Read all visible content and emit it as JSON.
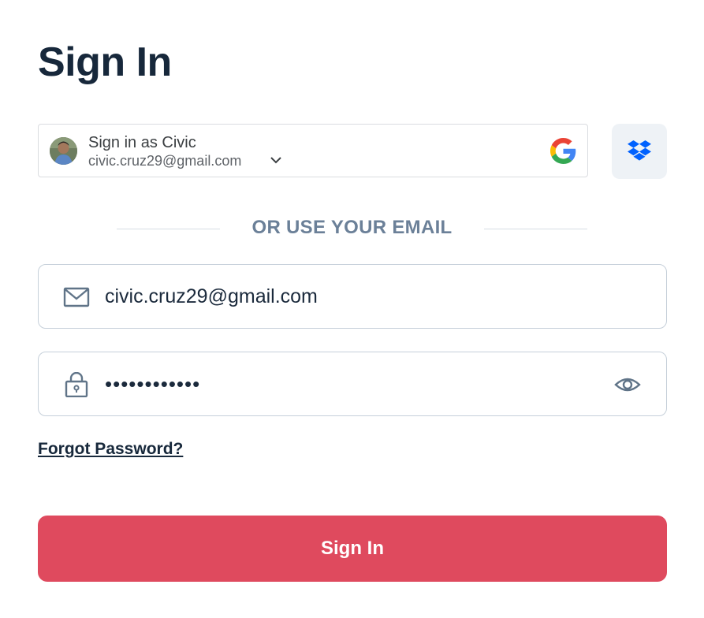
{
  "page": {
    "title": "Sign In"
  },
  "google_account": {
    "label": "Sign in as Civic",
    "email": "civic.cruz29@gmail.com",
    "provider_icon": "google-g-logo",
    "chevron_icon": "chevron-down"
  },
  "dropbox": {
    "icon": "dropbox-logo",
    "color": "#0061fe"
  },
  "divider": {
    "text": "OR USE YOUR EMAIL"
  },
  "email_field": {
    "value": "civic.cruz29@gmail.com",
    "icon": "envelope"
  },
  "password_field": {
    "value": "••••••••••••",
    "icon": "lock",
    "toggle_icon": "eye"
  },
  "links": {
    "forgot_password": "Forgot Password?"
  },
  "submit": {
    "label": "Sign In",
    "color": "#df4a5e"
  }
}
